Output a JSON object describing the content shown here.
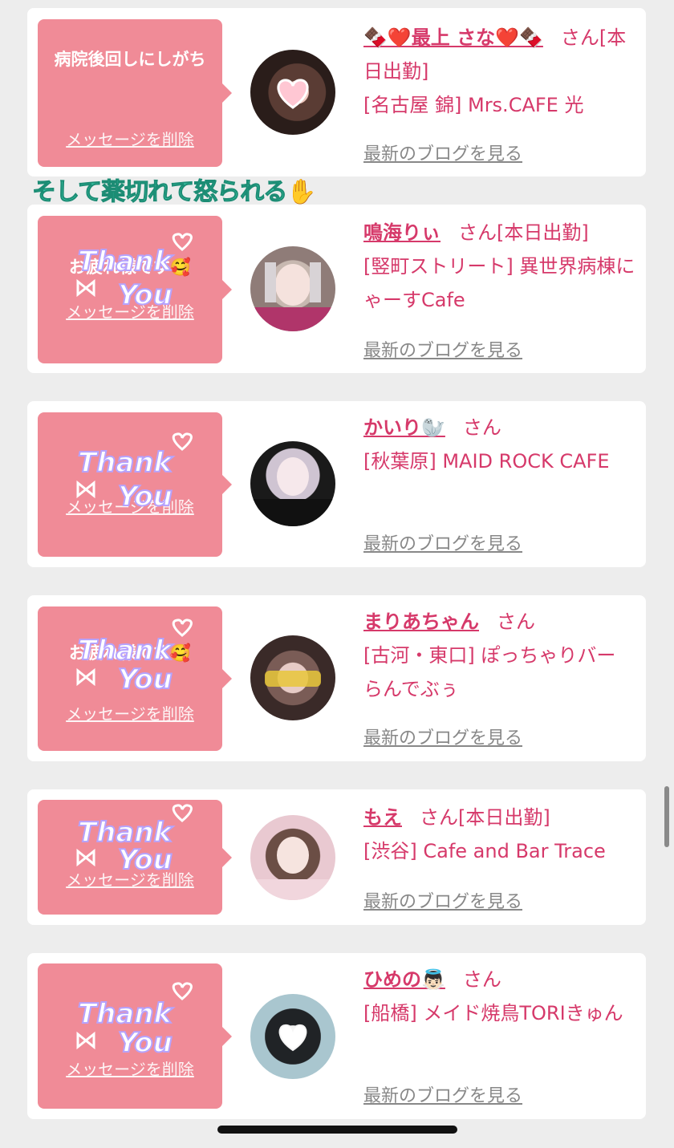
{
  "caption": "そして薬切れて怒られる✋",
  "common": {
    "blog_link": "最新のブログを見る",
    "delete_label": "メッセージを削除",
    "san": "さん"
  },
  "cards": [
    {
      "message": "病院後回しにしがち",
      "name": "🍫❤️最上 さな❤️🍫",
      "status": "[本日出勤]",
      "shop": "[名古屋 錦] Mrs.CAFE 光",
      "sticker": ""
    },
    {
      "message": "お疲れ様です🥰",
      "name": "鳴海りぃ",
      "status": "[本日出勤]",
      "shop": "[竪町ストリート] 異世界病棟にゃーすCafe",
      "sticker": "Thank You"
    },
    {
      "message": "",
      "name": "かいり🦭",
      "status": "",
      "shop": "[秋葉原] MAID ROCK CAFE",
      "sticker": "Thank You"
    },
    {
      "message": "お疲れ様です🥰",
      "name": "まりあちゃん",
      "status": "",
      "shop": "[古河・東口] ぽっちゃりバー らんでぶぅ",
      "sticker": "Thank You"
    },
    {
      "message": "",
      "name": "もえ",
      "status": "[本日出勤]",
      "shop": "[渋谷] Cafe and Bar Trace",
      "sticker": "Thank You"
    },
    {
      "message": "",
      "name": "ひめの👼🏻",
      "status": "",
      "shop": "[船橋] メイド焼鳥TORIきゅん",
      "sticker": "Thank You"
    }
  ],
  "colors": {
    "bubble": "#f08b97",
    "accent": "#d6396a",
    "card": "#ffffff",
    "background": "#ededed"
  }
}
